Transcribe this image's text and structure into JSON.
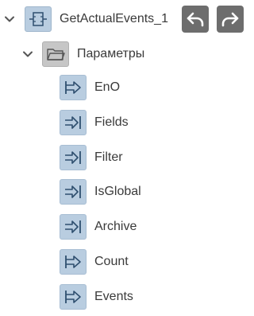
{
  "block": {
    "name": "GetActualEvents_1",
    "icon": "function-block-icon",
    "expanded": true
  },
  "toolbar": {
    "undo_icon": "undo-arrow-icon",
    "redo_icon": "redo-arrow-icon"
  },
  "params_folder": {
    "label": "Параметры",
    "icon": "folder-icon",
    "expanded": true
  },
  "pins": [
    {
      "label": "EnO",
      "direction": "output",
      "icon": "output-pin-icon"
    },
    {
      "label": "Fields",
      "direction": "input",
      "icon": "input-pin-icon"
    },
    {
      "label": "Filter",
      "direction": "input",
      "icon": "input-pin-icon"
    },
    {
      "label": "IsGlobal",
      "direction": "input",
      "icon": "input-pin-icon"
    },
    {
      "label": "Archive",
      "direction": "input",
      "icon": "input-pin-icon"
    },
    {
      "label": "Count",
      "direction": "output",
      "icon": "output-pin-icon"
    },
    {
      "label": "Events",
      "direction": "output",
      "icon": "output-pin-icon"
    }
  ],
  "colors": {
    "pin_bg": "#b9cde0",
    "folder_bg": "#c6c6c6",
    "button_bg": "#6d6d6d",
    "icon_stroke": "#2f4f6f"
  }
}
